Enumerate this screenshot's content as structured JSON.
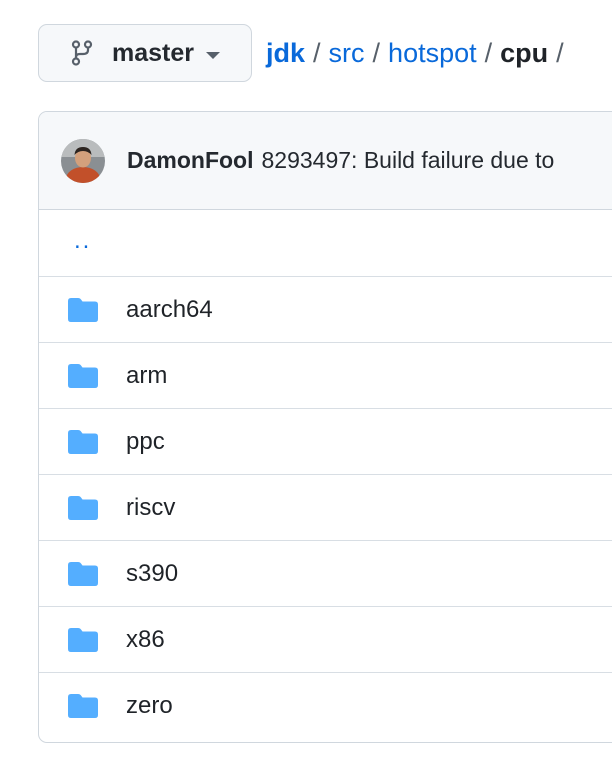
{
  "branch": {
    "icon": "git-branch-icon",
    "label": "master",
    "caret_icon": "triangle-down-icon"
  },
  "breadcrumb": {
    "root": "jdk",
    "items": [
      "src",
      "hotspot"
    ],
    "current": "cpu",
    "separator": "/"
  },
  "commit": {
    "avatar": "user-avatar",
    "author": "DamonFool",
    "message": "8293497: Build failure due to"
  },
  "files": {
    "parent_link": "..",
    "folder_icon": "file-directory-fill-icon",
    "folder_color": "#54aeff",
    "items": [
      "aarch64",
      "arm",
      "ppc",
      "riscv",
      "s390",
      "x86",
      "zero"
    ]
  },
  "colors": {
    "link": "#0969da",
    "border": "#d0d7de",
    "header_bg": "#f6f8fa"
  }
}
